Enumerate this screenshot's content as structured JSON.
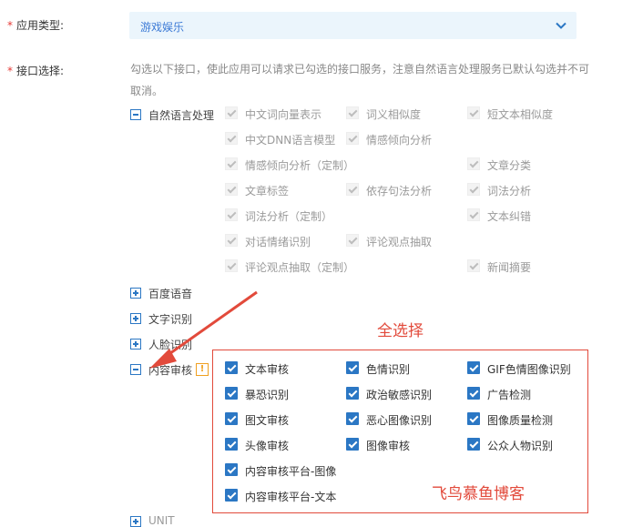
{
  "form": {
    "app_type": {
      "required_mark": "*",
      "label": "应用类型:",
      "value": "游戏娱乐",
      "icon": "chevron-down-icon"
    },
    "api_select": {
      "required_mark": "*",
      "label": "接口选择:",
      "note": "勾选以下接口，使此应用可以请求已勾选的接口服务，注意自然语言处理服务已默认勾选并不可取消。"
    }
  },
  "groups": {
    "nlp": {
      "label": "自然语言处理",
      "expanded": true,
      "items": [
        "中文词向量表示",
        "词义相似度",
        "短文本相似度",
        "中文DNN语言模型",
        "情感倾向分析",
        "情感倾向分析（定制）",
        "文章分类",
        "文章标签",
        "依存句法分析",
        "词法分析",
        "词法分析（定制）",
        "文本纠错",
        "对话情绪识别",
        "评论观点抽取",
        "评论观点抽取（定制）",
        "新闻摘要"
      ]
    },
    "speech": {
      "label": "百度语音",
      "expanded": false
    },
    "ocr": {
      "label": "文字识别",
      "expanded": false
    },
    "face": {
      "label": "人脸识别",
      "expanded": false
    },
    "audit": {
      "label": "内容审核",
      "expanded": true,
      "warning": "!",
      "items": [
        "文本审核",
        "色情识别",
        "GIF色情图像识别",
        "暴恐识别",
        "政治敏感识别",
        "广告检测",
        "图文审核",
        "恶心图像识别",
        "图像质量检测",
        "头像审核",
        "图像审核",
        "公众人物识别",
        "内容审核平台-图像",
        "内容审核平台-文本"
      ]
    },
    "unit": {
      "label": "UNIT"
    }
  },
  "annotations": {
    "select_all": "全选择",
    "watermark": "飞鸟慕鱼博客"
  },
  "colors": {
    "accent": "#2b77c4",
    "annotation_red": "#e24a3b",
    "select_bg": "#ebf5fc",
    "warning": "#f0a020"
  }
}
